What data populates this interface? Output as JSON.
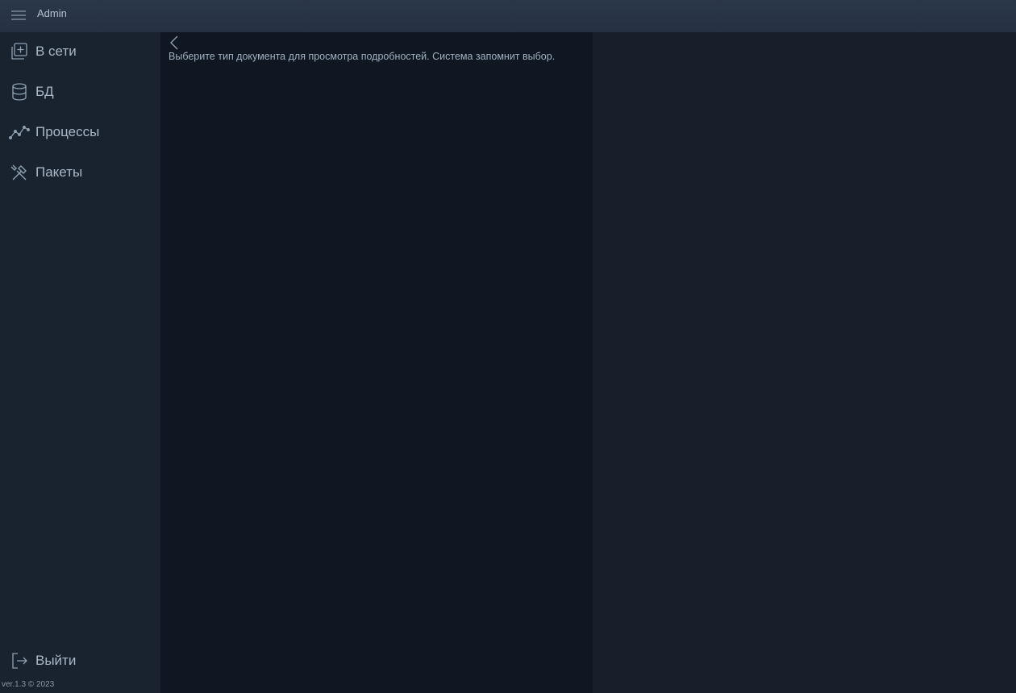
{
  "header": {
    "title": "Admin",
    "menu_icon": "menu-icon"
  },
  "sidebar": {
    "items": [
      {
        "label": "В сети",
        "icon": "add-square-icon"
      },
      {
        "label": "БД",
        "icon": "database-icon"
      },
      {
        "label": "Процессы",
        "icon": "chart-line-icon"
      },
      {
        "label": "Пакеты",
        "icon": "tools-icon"
      }
    ],
    "logout": {
      "label": "Выйти",
      "icon": "logout-icon"
    },
    "version": "ver.1.3 © 2023"
  },
  "panel": {
    "back_icon": "chevron-left-icon",
    "hint": "Выберите тип документа для просмотра подробностей. Система запомнит выбор."
  },
  "colors": {
    "topbar": "#283446",
    "sidebar": "#18232f",
    "panel": "#0f1722",
    "detail": "#17202a",
    "text": "#a9b7c6"
  }
}
